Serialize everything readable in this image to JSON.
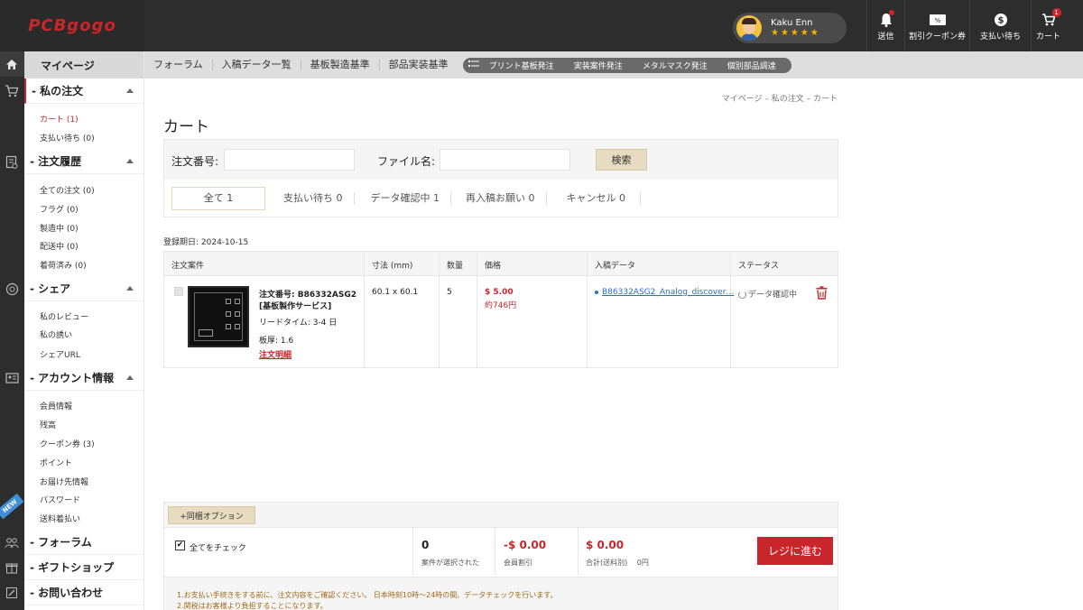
{
  "header": {
    "logo_text": "PCBgogo",
    "user_name": "Kaku Enn",
    "user_stars": "★★★★★",
    "items": [
      {
        "label": "送信",
        "icon": "bell-icon",
        "badge": ""
      },
      {
        "label": "割引クーポン券",
        "icon": "coupon-icon",
        "badge": ""
      },
      {
        "label": "支払い待ち",
        "icon": "dollar-icon",
        "badge": ""
      },
      {
        "label": "カート",
        "icon": "cart-icon",
        "badge": "1"
      }
    ]
  },
  "sidebar": {
    "title": "マイページ",
    "sections": [
      {
        "label": "- 私の注文",
        "links": [
          "カート (1)",
          "支払い待ち (0)"
        ]
      },
      {
        "label": "- 注文履歴",
        "links": [
          "全ての注文 (0)",
          "フラグ (0)",
          "製造中 (0)",
          "配送中 (0)",
          "着荷済み (0)"
        ]
      },
      {
        "label": "- シェア",
        "links": [
          "私のレビュー",
          "私の誘い",
          "シェアURL"
        ]
      },
      {
        "label": "- アカウント情報",
        "links": [
          "会員情報",
          "残高",
          "クーポン券 (3)",
          "ポイント",
          "お届け先情報",
          "パスワード",
          "送料着払い"
        ]
      },
      {
        "label": "- フォーラム",
        "links": []
      },
      {
        "label": "- ギフトショップ",
        "links": []
      },
      {
        "label": "- お問い合わせ",
        "links": []
      }
    ],
    "new_badge": "NEW"
  },
  "nav": {
    "links": [
      "フォーラム",
      "入稿データ一覧",
      "基板製造基準",
      "部品実装基準"
    ],
    "pill_items": [
      "プリント基板発注",
      "実装案件発注",
      "メタルマスク発注",
      "個別部品調達"
    ]
  },
  "breadcrumb": "マイページ – 私の注文 – カート",
  "page_title": "カート",
  "filter": {
    "order_no_label": "注文番号:",
    "order_no_value": "",
    "file_name_label": "ファイル名:",
    "file_name_value": "",
    "search_label": "検索"
  },
  "tabs": [
    "全て 1",
    "支払い待ち 0",
    "データ確認中 1",
    "再入稿お願い 0",
    "キャンセル 0"
  ],
  "registration": "登録期日: 2024-10-15",
  "table": {
    "headers": [
      "注文案件",
      "寸法 (mm)",
      "数量",
      "価格",
      "入稿データ",
      "ステータス"
    ],
    "row": {
      "order_no": "注文番号: B86332ASG2",
      "service": "[基板製作サービス]",
      "lead_time": "リードタイム: 3-4 日",
      "thickness": "板厚: 1.6",
      "detail_link": "注文明細",
      "size": "60.1 x 60.1",
      "qty": "5",
      "price_usd": "$ 5.00",
      "price_jpy": "約746円",
      "file": "B86332ASG2_Analog_discover…",
      "status": "データ確認中"
    }
  },
  "summary": {
    "option_button": "+同梱オプション",
    "check_all": "全てをチェック",
    "selected_count": "0",
    "selected_label": "案件が選択された",
    "discount": "-$ 0.00",
    "discount_label": "会員割引",
    "total": "$ 0.00",
    "total_label": "合計(送料別)",
    "total_jpy": "0円",
    "checkout": "レジに進む"
  },
  "notes": [
    "1.お支払い手続きをする前に、注文内容をご確認ください。 日本時刻10時〜24時の間、データチェックを行います。",
    "2.関税はお客様より負担することになります。"
  ]
}
